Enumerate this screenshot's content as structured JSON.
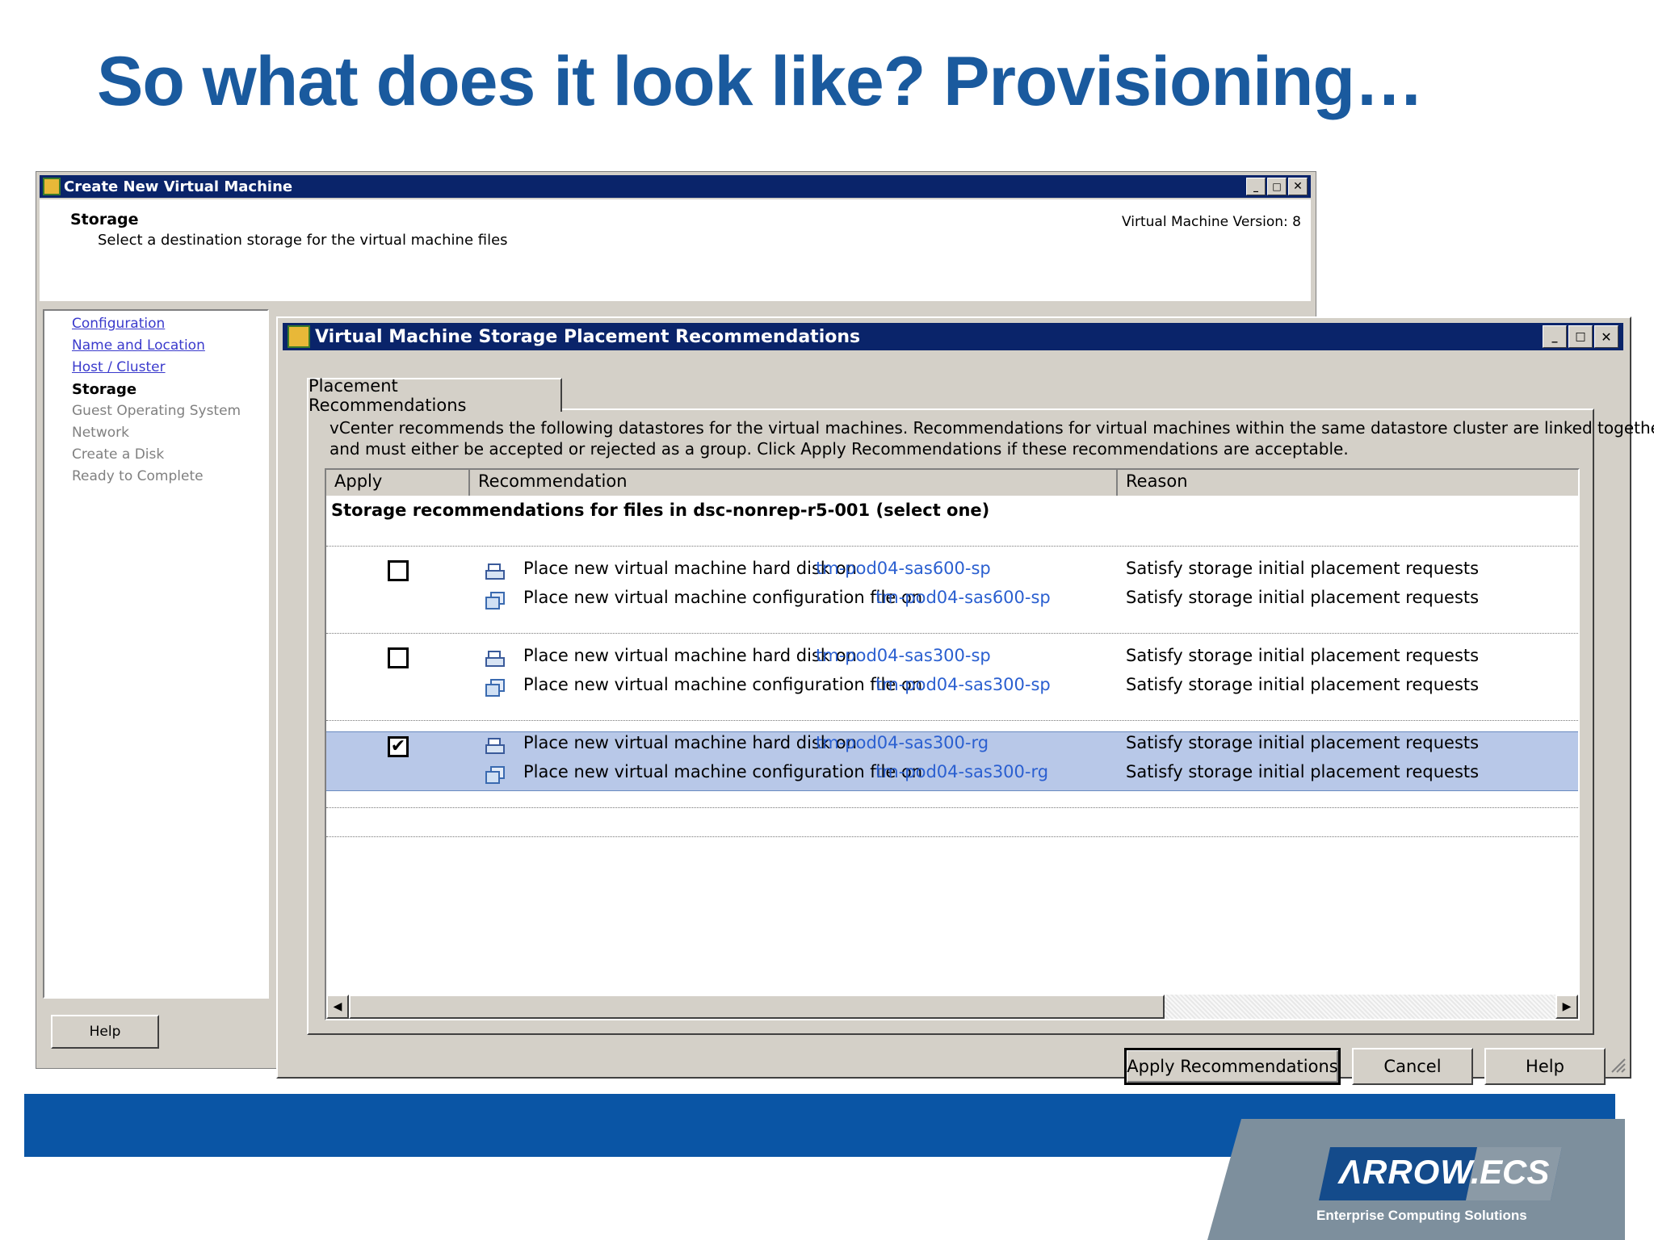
{
  "slide": {
    "title": "So what does it look like? Provisioning…",
    "logo_brand": "ΛRROW.",
    "logo_ecs": "ECS",
    "logo_sub": "Enterprise Computing Solutions"
  },
  "bg_window": {
    "title": "Create New Virtual Machine",
    "header_title": "Storage",
    "header_subtitle": "Select a destination storage for the virtual machine files",
    "version": "Virtual Machine Version: 8",
    "nav": [
      {
        "label": "Configuration",
        "state": "link"
      },
      {
        "label": "Name and Location",
        "state": "link"
      },
      {
        "label": "Host / Cluster",
        "state": "link"
      },
      {
        "label": "Storage",
        "state": "current"
      },
      {
        "label": "Guest Operating System",
        "state": "disabled"
      },
      {
        "label": "Network",
        "state": "disabled"
      },
      {
        "label": "Create a Disk",
        "state": "disabled"
      },
      {
        "label": "Ready to Complete",
        "state": "disabled"
      }
    ],
    "help_label": "Help"
  },
  "dialog": {
    "title": "Virtual Machine Storage Placement Recommendations",
    "tab": "Placement Recommendations",
    "description_line1": "vCenter recommends the following datastores for the virtual machines. Recommendations for virtual machines within the same datastore cluster are linked together",
    "description_line2": "and must either be accepted or rejected as a group. Click Apply Recommendations if these recommendations are acceptable.",
    "columns": {
      "apply": "Apply",
      "recommendation": "Recommendation",
      "reason": "Reason"
    },
    "group_header": "Storage recommendations for files in dsc-nonrep-r5-001 (select one)",
    "groups": [
      {
        "checked": false,
        "rows": [
          {
            "icon": "hard-disk-icon",
            "text": "Place new virtual machine hard disk on",
            "datastore": "tm-pod04-sas600-sp",
            "reason": "Satisfy storage initial placement requests"
          },
          {
            "icon": "config-file-icon",
            "text": "Place new virtual machine configuration file on",
            "datastore": "tm-pod04-sas600-sp",
            "reason": "Satisfy storage initial placement requests"
          }
        ]
      },
      {
        "checked": false,
        "rows": [
          {
            "icon": "hard-disk-icon",
            "text": "Place new virtual machine hard disk on",
            "datastore": "tm-pod04-sas300-sp",
            "reason": "Satisfy storage initial placement requests"
          },
          {
            "icon": "config-file-icon",
            "text": "Place new virtual machine configuration file on",
            "datastore": "tm-pod04-sas300-sp",
            "reason": "Satisfy storage initial placement requests"
          }
        ]
      },
      {
        "checked": true,
        "rows": [
          {
            "icon": "hard-disk-icon",
            "text": "Place new virtual machine hard disk on",
            "datastore": "tm-pod04-sas300-rg",
            "reason": "Satisfy storage initial placement requests"
          },
          {
            "icon": "config-file-icon",
            "text": "Place new virtual machine configuration file on",
            "datastore": "tm-pod04-sas300-rg",
            "reason": "Satisfy storage initial placement requests"
          }
        ]
      }
    ],
    "buttons": {
      "apply": "Apply Recommendations",
      "cancel": "Cancel",
      "help": "Help"
    }
  },
  "colors": {
    "title_blue": "#1a5a9e",
    "titlebar": "#0a246a",
    "selected_row": "#b8c8e8",
    "link": "#2a5fd0"
  }
}
